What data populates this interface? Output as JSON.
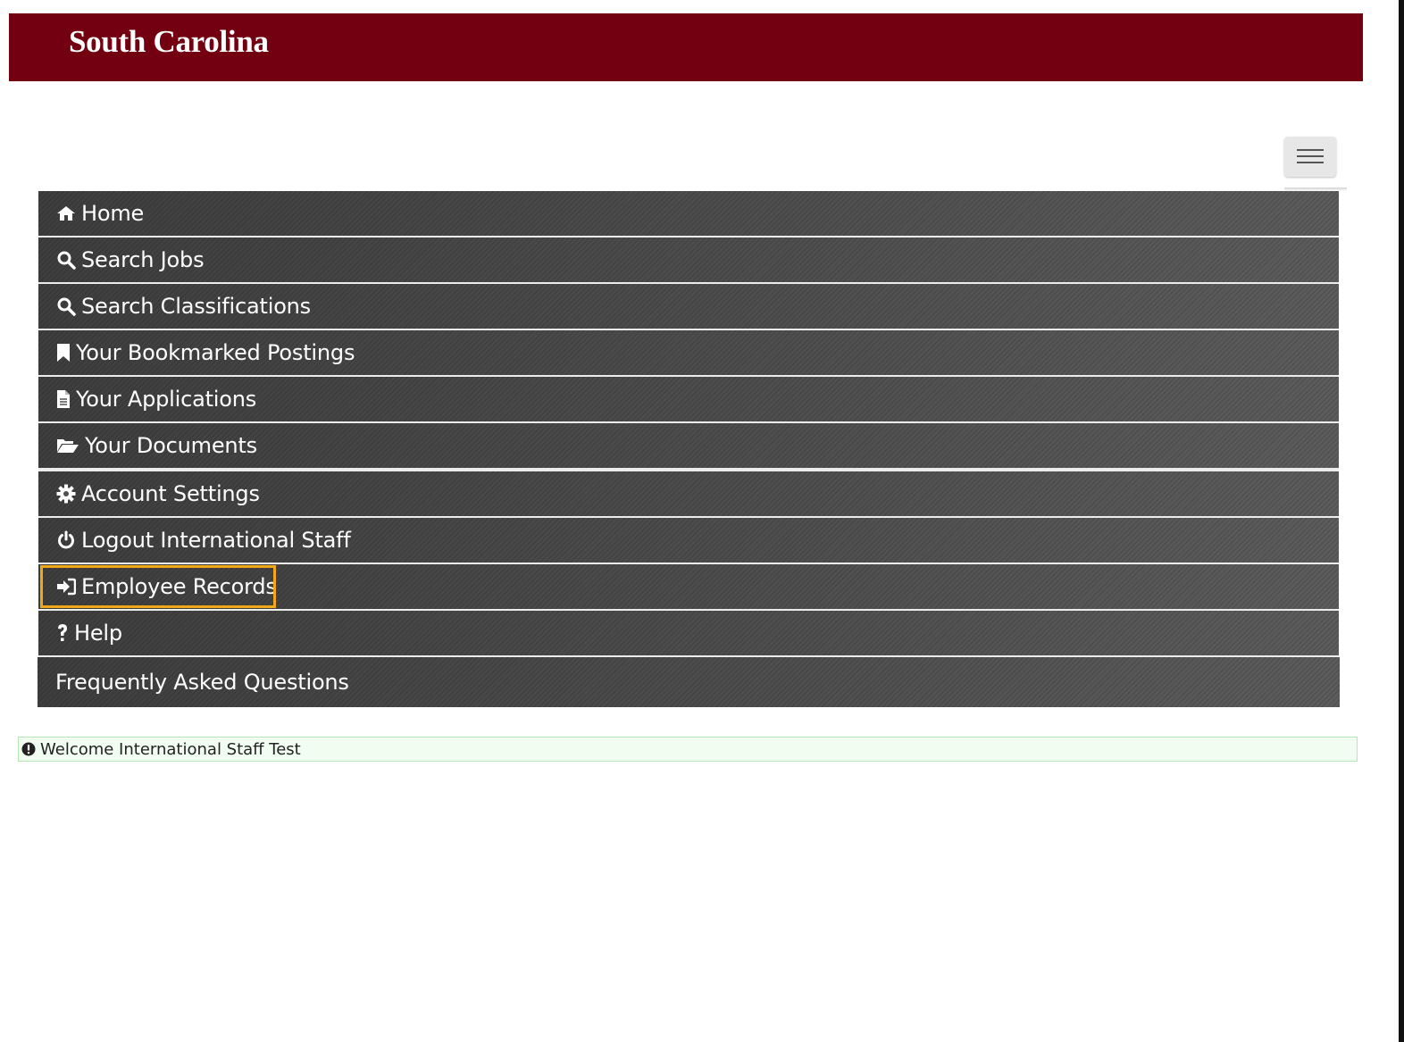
{
  "header": {
    "brand": "South Carolina",
    "background_color": "#720010"
  },
  "menu_toggle": {
    "icon": "hamburger-menu-icon"
  },
  "nav": {
    "items": [
      {
        "label": "Home",
        "icon": "home-icon"
      },
      {
        "label": "Search Jobs",
        "icon": "search-icon"
      },
      {
        "label": "Search Classifications",
        "icon": "search-icon"
      },
      {
        "label": "Your Bookmarked Postings",
        "icon": "bookmark-icon"
      },
      {
        "label": "Your Applications",
        "icon": "document-icon"
      },
      {
        "label": "Your Documents",
        "icon": "folder-open-icon"
      },
      {
        "label": "Account Settings",
        "icon": "gear-icon"
      },
      {
        "label": "Logout International Staff",
        "icon": "power-icon"
      },
      {
        "label": "Employee Records",
        "icon": "sign-in-icon",
        "focused": true
      },
      {
        "label": "Help",
        "icon": "question-icon"
      },
      {
        "label": "Frequently Asked Questions",
        "icon": ""
      }
    ],
    "focus_color": "#f0a818"
  },
  "notice": {
    "icon": "info-icon",
    "text": "Welcome International Staff Test",
    "background_color": "#f2fdf2",
    "border_color": "#b4e8b4"
  }
}
